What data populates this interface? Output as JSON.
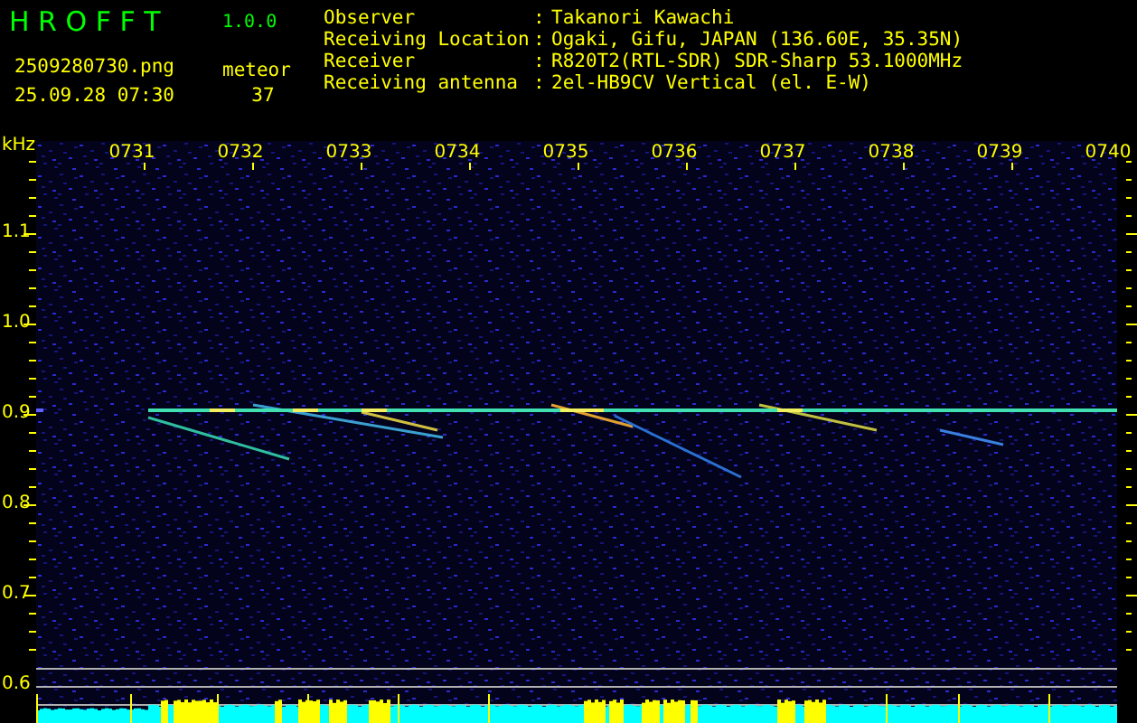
{
  "app": {
    "title": "H R O F F T",
    "version": "1.0.0",
    "filename": "2509280730.png",
    "datetime": "25.09.28 07:30",
    "count_label": "meteor",
    "count": "37"
  },
  "station_info": [
    {
      "label": "Observer",
      "separator": ":",
      "value": "Takanori Kawachi"
    },
    {
      "label": "Receiving Location",
      "separator": ":",
      "value": "Ogaki, Gifu, JAPAN (136.60E, 35.35N)"
    },
    {
      "label": "Receiver",
      "separator": ":",
      "value": "R820T2(RTL-SDR) SDR-Sharp 53.1000MHz"
    },
    {
      "label": "Receiving antenna",
      "separator": ":",
      "value": "2el-HB9CV Vertical (el. E-W)"
    }
  ],
  "spectrogram": {
    "unit": "kHz",
    "time_labels": [
      "0731",
      "0732",
      "0733",
      "0734",
      "0735",
      "0736",
      "0737",
      "0738",
      "0739",
      "0740"
    ],
    "frequency_labels": [
      "1.1",
      "1.0",
      "0.9",
      "0.8",
      "0.7",
      "0.6"
    ]
  }
}
